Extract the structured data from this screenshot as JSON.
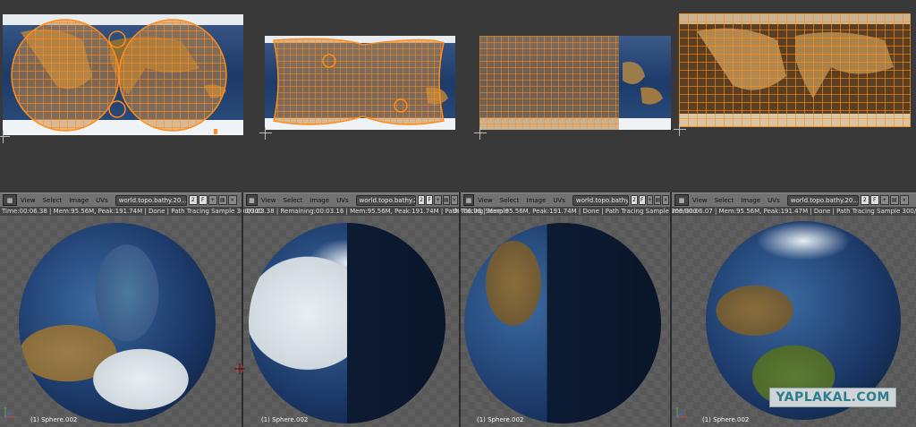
{
  "uv_editors": [
    {
      "name": "uv-panel-1"
    },
    {
      "name": "uv-panel-2"
    },
    {
      "name": "uv-panel-3"
    },
    {
      "name": "uv-panel-4"
    }
  ],
  "headers": [
    {
      "menus": [
        "View",
        "Select",
        "Image",
        "UVs"
      ],
      "image_name": "world.topo.bathy.20...",
      "slot": "2",
      "f": "F"
    },
    {
      "menus": [
        "View",
        "Select",
        "Image",
        "UVs"
      ],
      "image_name": "world.topo.bathy.20...",
      "slot": "2",
      "f": "F"
    },
    {
      "menus": [
        "View",
        "Select",
        "Image",
        "UVs"
      ],
      "image_name": "world.topo.bathy.20...",
      "slot": "2",
      "f": "F"
    },
    {
      "menus": [
        "View",
        "Select",
        "Image",
        "UVs"
      ],
      "image_name": "world.topo.bathy.20...",
      "slot": "2",
      "f": "F"
    }
  ],
  "status": [
    "Time:00:06.38 | Mem:95.56M, Peak:191.74M | Done | Path Tracing Sample 300/300",
    ":00:03.38 | Remaining:00:03.16 | Mem:95.56M, Peak:191.74M | Path Tracing Sample",
    "00:06.06 | Mem:95.56M, Peak:191.74M | Done | Path Tracing Sample 300/300",
    "ime:00:06.07 | Mem:95.56M, Peak:191.47M | Done | Path Tracing Sample 300/300"
  ],
  "viewports": [
    {
      "object_label": "(1) Sphere.002"
    },
    {
      "object_label": "(1) Sphere.002"
    },
    {
      "object_label": "(1) Sphere.002"
    },
    {
      "object_label": "(1) Sphere.002"
    }
  ],
  "watermark": "YAPLAKAL.COM",
  "colors": {
    "uv_wire": "#ff8c1a",
    "ocean": "#1c3a6a",
    "land": "#8a6d3b",
    "ice": "#e8eef2"
  }
}
